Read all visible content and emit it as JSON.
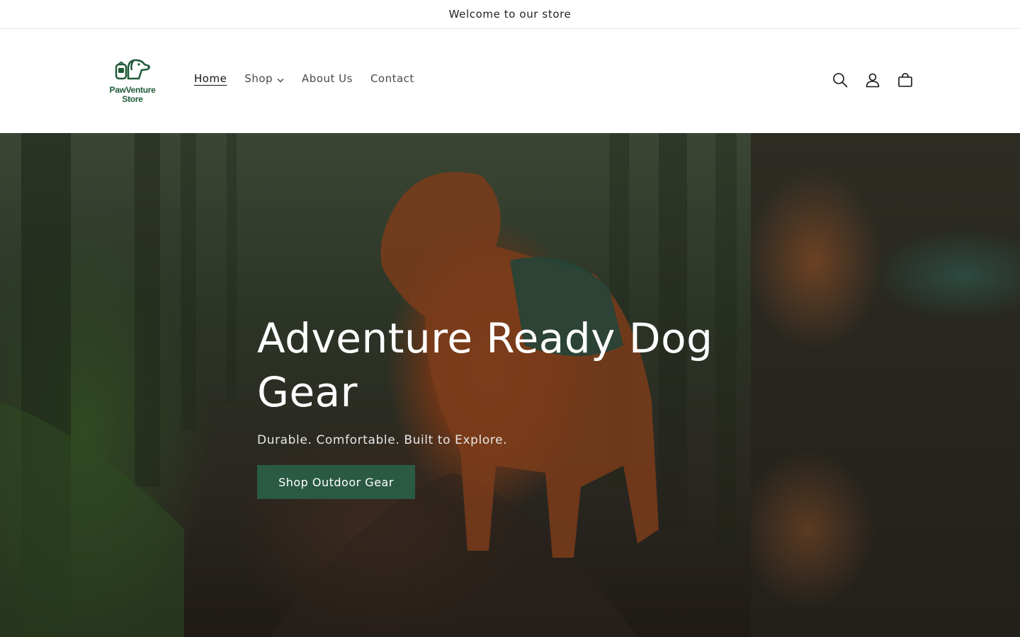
{
  "announcement": {
    "text": "Welcome to our store"
  },
  "logo": {
    "line1": "PawVenture",
    "line2": "Store",
    "color": "#1f5a37"
  },
  "nav": {
    "items": [
      {
        "label": "Home",
        "active": true
      },
      {
        "label": "Shop",
        "has_dropdown": true
      },
      {
        "label": "About Us"
      },
      {
        "label": "Contact"
      }
    ]
  },
  "header_icons": [
    "search-icon",
    "account-icon",
    "cart-icon"
  ],
  "hero": {
    "title": "Adventure Ready Dog Gear",
    "subtitle": "Durable. Comfortable. Built to Explore.",
    "button_label": "Shop Outdoor Gear",
    "button_color": "#2a5a43"
  }
}
